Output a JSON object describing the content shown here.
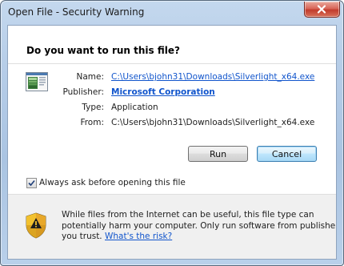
{
  "window": {
    "title": "Open File - Security Warning"
  },
  "dialog": {
    "heading": "Do you want to run this file?",
    "fields": {
      "name_label": "Name:",
      "name_value": "C:\\Users\\bjohn31\\Downloads\\Silverlight_x64.exe",
      "publisher_label": "Publisher:",
      "publisher_value": "Microsoft Corporation",
      "type_label": "Type:",
      "type_value": "Application",
      "from_label": "From:",
      "from_value": "C:\\Users\\bjohn31\\Downloads\\Silverlight_x64.exe"
    },
    "buttons": {
      "run_label": "Run",
      "cancel_label": "Cancel"
    },
    "checkbox": {
      "label": "Always ask before opening this file",
      "checked": true
    },
    "warning": {
      "line1": "While files from the Internet can be useful, this file type can",
      "line2": "potentially harm your computer. Only run software from publishers",
      "line3_prefix": "you trust.",
      "risk_link": "What's the risk?"
    }
  },
  "icons": {
    "close": "close-icon",
    "file": "application-file-icon",
    "shield": "security-shield-icon",
    "check": "checkmark-icon"
  },
  "colors": {
    "link": "#1155cc",
    "title_bar": "#b6cde8",
    "close_button": "#c23c2c",
    "footer_background": "#f0f0f0"
  }
}
